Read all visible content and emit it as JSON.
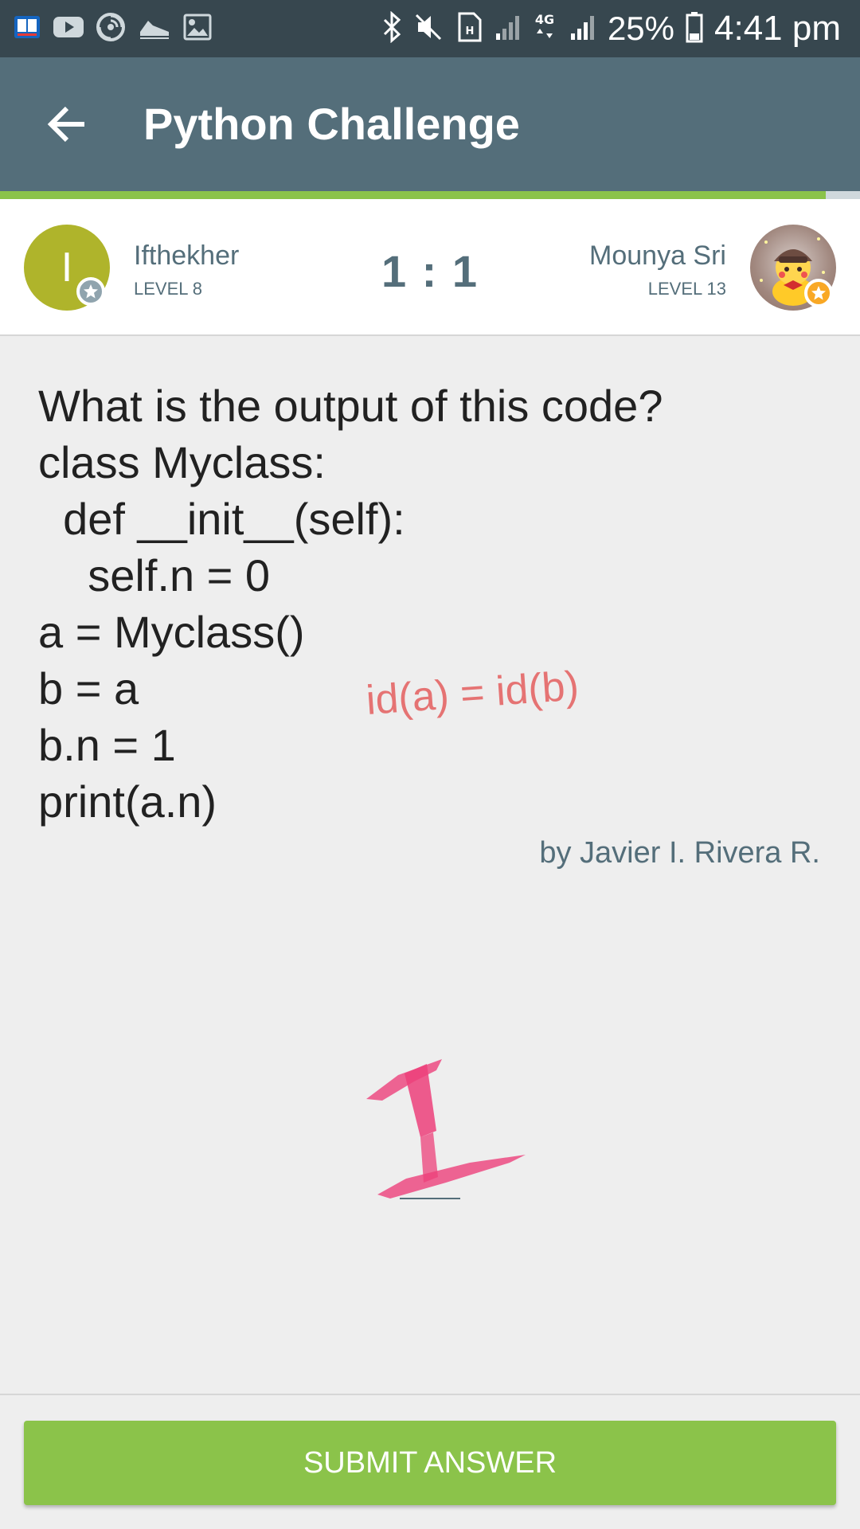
{
  "status_bar": {
    "icons_left": [
      "dictionary-app-icon",
      "youtube-icon",
      "spiral-app-icon",
      "shoe-app-icon",
      "image-icon"
    ],
    "icons_right": [
      "bluetooth-icon",
      "mute-icon",
      "hd-icon",
      "signal-icon",
      "4g-icon",
      "signal-icon"
    ],
    "network": "4G",
    "battery_pct": "25%",
    "time": "4:41 pm"
  },
  "app_bar": {
    "title": "Python Challenge",
    "back_icon": "back-arrow-icon"
  },
  "progress": {
    "fraction": 0.96,
    "color": "#8bc34a"
  },
  "players": {
    "left": {
      "initial": "I",
      "name": "Ifthekher",
      "level": "LEVEL 8",
      "avatar_color": "#afb42b"
    },
    "score": "1 : 1",
    "right": {
      "name": "Mounya Sri",
      "level": "LEVEL 13"
    }
  },
  "question": {
    "lines": [
      "What is the output of this code?",
      "class Myclass:",
      "  def __init__(self):",
      "    self.n = 0",
      "a = Myclass()",
      "b = a",
      "b.n = 1",
      "print(a.n)"
    ],
    "author": "by Javier I. Rivera R."
  },
  "annotations": {
    "scribble": "id(a) = id(b)",
    "handwritten_answer": "1"
  },
  "answer": {
    "value": ""
  },
  "submit": {
    "label": "SUBMIT ANSWER",
    "color": "#8bc34a"
  },
  "colors": {
    "status_bar": "#37474f",
    "app_bar": "#546e7a",
    "background": "#eeeeee",
    "scribble": "#e57373",
    "answer_ink": "#ec407a"
  }
}
